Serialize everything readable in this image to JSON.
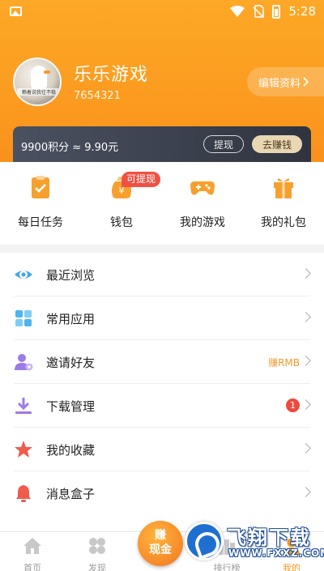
{
  "status_bar": {
    "time": "5:28",
    "icons": [
      "image-icon",
      "wifi-icon",
      "no-sim-icon",
      "battery-icon"
    ]
  },
  "profile": {
    "name": "乐乐游戏",
    "id": "7654321",
    "avatar_caption": "赖着说我往不稳",
    "edit_label": "编辑资料",
    "edit_icon": "chevron-right-icon"
  },
  "points": {
    "text": "9900积分 ≈ 9.90元",
    "withdraw_label": "提现",
    "earn_label": "去赚钱"
  },
  "quick_actions": [
    {
      "label": "每日任务",
      "icon": "task-clipboard-icon"
    },
    {
      "label": "钱包",
      "icon": "wallet-bag-icon",
      "badge": "可提现"
    },
    {
      "label": "我的游戏",
      "icon": "gamepad-icon"
    },
    {
      "label": "我的礼包",
      "icon": "gift-icon"
    }
  ],
  "menu": [
    {
      "label": "最近浏览",
      "icon": "eye-icon"
    },
    {
      "label": "常用应用",
      "icon": "apps-grid-icon"
    },
    {
      "label": "邀请好友",
      "icon": "invite-user-icon",
      "extra": "赚RMB"
    },
    {
      "label": "下载管理",
      "icon": "download-icon",
      "count": "1"
    },
    {
      "label": "我的收藏",
      "icon": "star-icon"
    },
    {
      "label": "消息盒子",
      "icon": "bell-icon"
    }
  ],
  "tabs": [
    {
      "label": "首页",
      "icon": "home-icon"
    },
    {
      "label": "发现",
      "icon": "discover-grid-icon"
    },
    {
      "label": "排行榜",
      "icon": "ranking-icon"
    },
    {
      "label": "我的",
      "icon": "profile-icon",
      "active": true
    }
  ],
  "earn_cash_button": {
    "line1": "赚",
    "line2": "现金"
  },
  "watermark": {
    "title": "飞翔下载",
    "url": "WWW.FXXZ.COM"
  },
  "colors": {
    "accent": "#f59a22",
    "header": "#fb9a1f",
    "badge_red": "#ef5042",
    "points_bar": "#3b414d"
  }
}
